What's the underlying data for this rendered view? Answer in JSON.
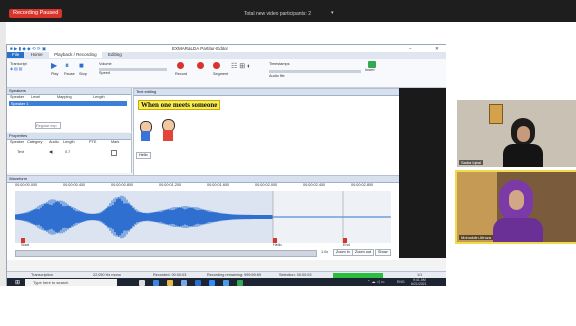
{
  "meeting": {
    "recording_badge": "Recording Paused",
    "participants_title": "Total new video participants: 2",
    "dropdown_glyph": "▾"
  },
  "app": {
    "window_title": "EXMARaLDA Partitur-Editor",
    "tabs": [
      "File",
      "Home",
      "Playback / Recording",
      "Editing"
    ],
    "active_tab": "Playback / Recording",
    "ribbon": {
      "group_labels": [
        "Transcript",
        "Audio file"
      ],
      "buttons": [
        "Play",
        "Pause",
        "Stop",
        "Loop",
        "Record",
        "Segment"
      ],
      "volume_label": "Volume",
      "speed_label": "Speed",
      "timestamps_label": "Timestamps",
      "insert_label": "Insert"
    },
    "speakers_panel": {
      "title": "Speakers",
      "columns": [
        "Speaker",
        "Level",
        "Mapping",
        "Length"
      ],
      "selected_row": "Speaker 1",
      "search_placeholder": "Regular exp."
    },
    "properties_panel": {
      "title": "Properties",
      "columns": [
        "Speaker",
        "Category",
        "Audio",
        "Length",
        "PTE",
        "Mark"
      ],
      "row": {
        "speaker": "Text",
        "audio": "◀)",
        "length": "0.7"
      }
    },
    "text_panel": {
      "tab": "Text editing",
      "sentence": "When one meets someone",
      "small_label": "Hello"
    },
    "waveform": {
      "title": "Waveform",
      "ticks": [
        "00:00:00.000",
        "00:00:00.400",
        "00:00:00.800",
        "00:00:01.200",
        "00:00:01.600",
        "00:00:02.000",
        "00:00:02.400",
        "00:00:02.800"
      ],
      "markers": [
        "Start",
        "Hello",
        "End"
      ],
      "zoom_in": "Zoom in",
      "zoom_out": "Zoom out",
      "show": "Show",
      "position_label": "1.0x"
    },
    "status": {
      "items": [
        "Transcription",
        "22,050 Hz mono",
        "Recorded: 00:00:03",
        "Recording remaining: 999:59:59",
        "Selection: 00:00:03"
      ],
      "page": "1/1"
    }
  },
  "taskbar": {
    "search_placeholder": "Type here to search",
    "time": "9:41 AM",
    "date": "6/21/2021",
    "lang": "ENG"
  },
  "participants": [
    {
      "name": "Sadia Iqbal"
    },
    {
      "name": "Mohuddin Afroza"
    }
  ],
  "colors": {
    "accent": "#2a6fc9",
    "record_red": "#d9342b",
    "waveform": "#2e6fd0",
    "active_speaker_border": "#f0d94a"
  }
}
